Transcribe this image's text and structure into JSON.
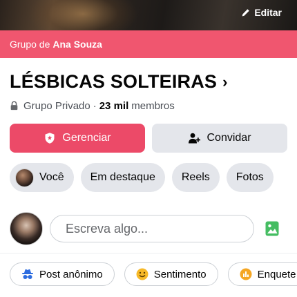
{
  "cover": {
    "edit_label": "Editar"
  },
  "banner": {
    "prefix": "Grupo de",
    "owner": "Ana Souza"
  },
  "group": {
    "name": "LÉSBICAS SOLTEIRAS",
    "chevron": "›",
    "privacy": "Grupo Privado",
    "separator": "·",
    "members_count": "23 mil",
    "members_label": "membros"
  },
  "buttons": {
    "manage": "Gerenciar",
    "invite": "Convidar"
  },
  "tabs": [
    {
      "label": "Você"
    },
    {
      "label": "Em destaque"
    },
    {
      "label": "Reels"
    },
    {
      "label": "Fotos"
    }
  ],
  "composer": {
    "placeholder": "Escreva algo..."
  },
  "actions": [
    {
      "label": "Post anônimo",
      "icon": "incognito-icon"
    },
    {
      "label": "Sentimento",
      "icon": "smiley-icon"
    },
    {
      "label": "Enquete",
      "icon": "poll-icon"
    }
  ],
  "colors": {
    "banner": "#f0566f",
    "manage_button": "#ec4a68",
    "chip_bg": "#e4e6eb",
    "photo_icon": "#45bd62",
    "incognito_icon": "#2d6cdf",
    "smiley_icon": "#f7b928",
    "poll_icon": "#f5a623"
  }
}
